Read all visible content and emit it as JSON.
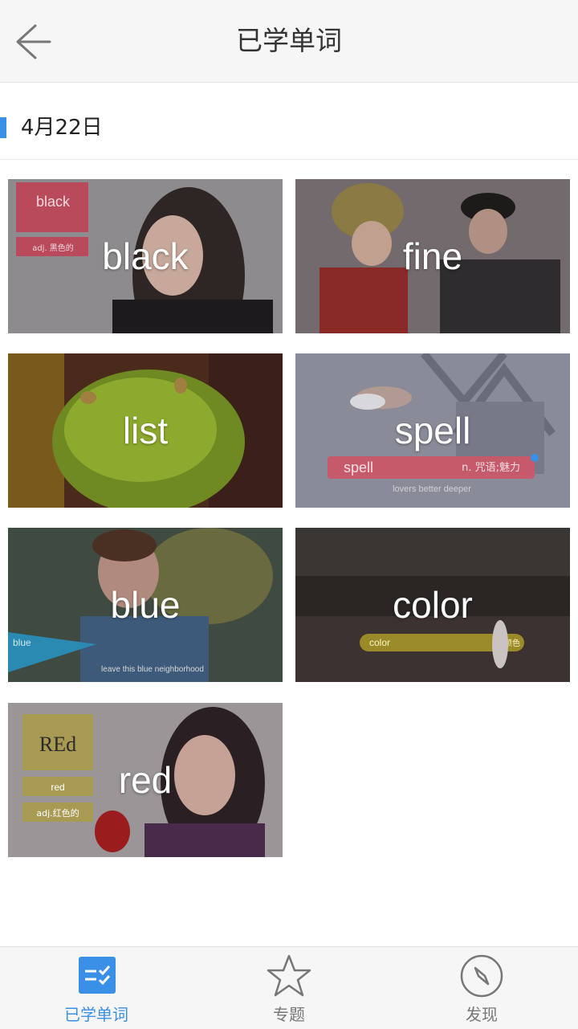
{
  "header": {
    "title": "已学单词"
  },
  "section": {
    "date": "4月22日",
    "accent_color": "#3a8fe6"
  },
  "words": [
    {
      "word": "black",
      "overlay_label": "black",
      "overlay_sub": "adj. 黑色的",
      "bg": "#8d8a8e"
    },
    {
      "word": "fine",
      "bg": "#6e6468"
    },
    {
      "word": "list",
      "bg": "#5d4a22"
    },
    {
      "word": "spell",
      "overlay_label": "spell",
      "overlay_sub": "n. 咒语;魅力",
      "caption": "lovers better deeper",
      "bg": "#8a8b9a"
    },
    {
      "word": "blue",
      "overlay_label": "blue",
      "caption": "leave this blue neighborhood",
      "bg": "#4a5248"
    },
    {
      "word": "color",
      "overlay_label": "color",
      "overlay_sub": "n. 颜色",
      "bg": "#2e2a28"
    },
    {
      "word": "red",
      "overlay_label": "REd",
      "overlay_sub": "red",
      "overlay_sub2": "adj.红色的",
      "bg": "#9a9496"
    }
  ],
  "nav": {
    "active_color": "#3a8fe6",
    "inactive_color": "#777777",
    "items": [
      {
        "label": "已学单词",
        "icon": "checklist-icon",
        "active": true
      },
      {
        "label": "专题",
        "icon": "star-icon",
        "active": false
      },
      {
        "label": "发现",
        "icon": "compass-icon",
        "active": false
      }
    ]
  }
}
